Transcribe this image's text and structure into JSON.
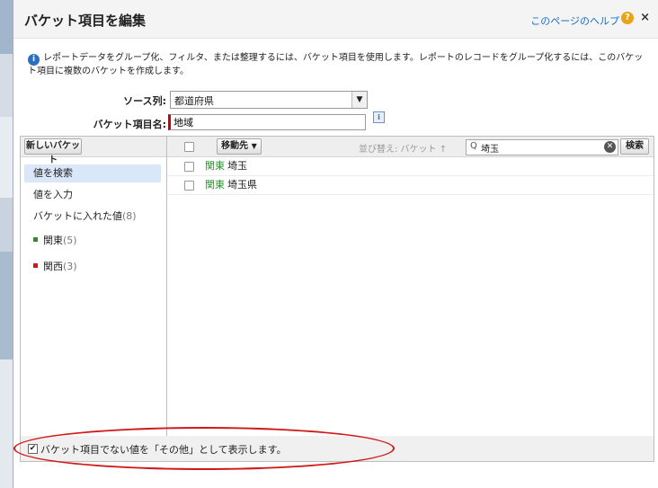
{
  "dialog": {
    "title": "バケット項目を編集",
    "help_link": "このページのヘルプ",
    "help_glyph": "?",
    "close_glyph": "×"
  },
  "info": {
    "icon_glyph": "i",
    "text": "レポートデータをグループ化、フィルタ、または整理するには、バケット項目を使用します。レポートのレコードをグループ化するには、このバケット項目に複数のバケットを作成します。"
  },
  "form": {
    "source_label": "ソース列:",
    "source_value": "都道府県",
    "bucket_name_label": "バケット項目名:",
    "bucket_name_value": "地域",
    "info_glyph": "i"
  },
  "left_panel": {
    "new_bucket_button": "新しいバケット",
    "items": [
      {
        "label": "値を検索",
        "active": true
      },
      {
        "label": "値を入力",
        "active": false
      },
      {
        "label": "バケットに入れた値",
        "count": "(8)"
      }
    ],
    "buckets": [
      {
        "label": "関東",
        "count": "(5)",
        "color": "#2d8f2d"
      },
      {
        "label": "関西",
        "count": "(3)",
        "color": "#d01818"
      }
    ]
  },
  "right_panel": {
    "move_to_label": "移動先",
    "sort_label": "並び替え: バケット ↑",
    "search_value": "埼玉",
    "search_button": "検索",
    "clear_glyph": "✕",
    "rows": [
      {
        "category": "関東",
        "value": "埼玉"
      },
      {
        "category": "関東",
        "value": "埼玉県"
      }
    ]
  },
  "footer": {
    "checkbox_checked": true,
    "check_glyph": "✔",
    "text": "バケット項目でない値を「その他」として表示します。"
  },
  "colors": {
    "highlight_ellipse": "#d01818",
    "link": "#1a6ec9",
    "selected_nav": "#d9e7f8"
  }
}
